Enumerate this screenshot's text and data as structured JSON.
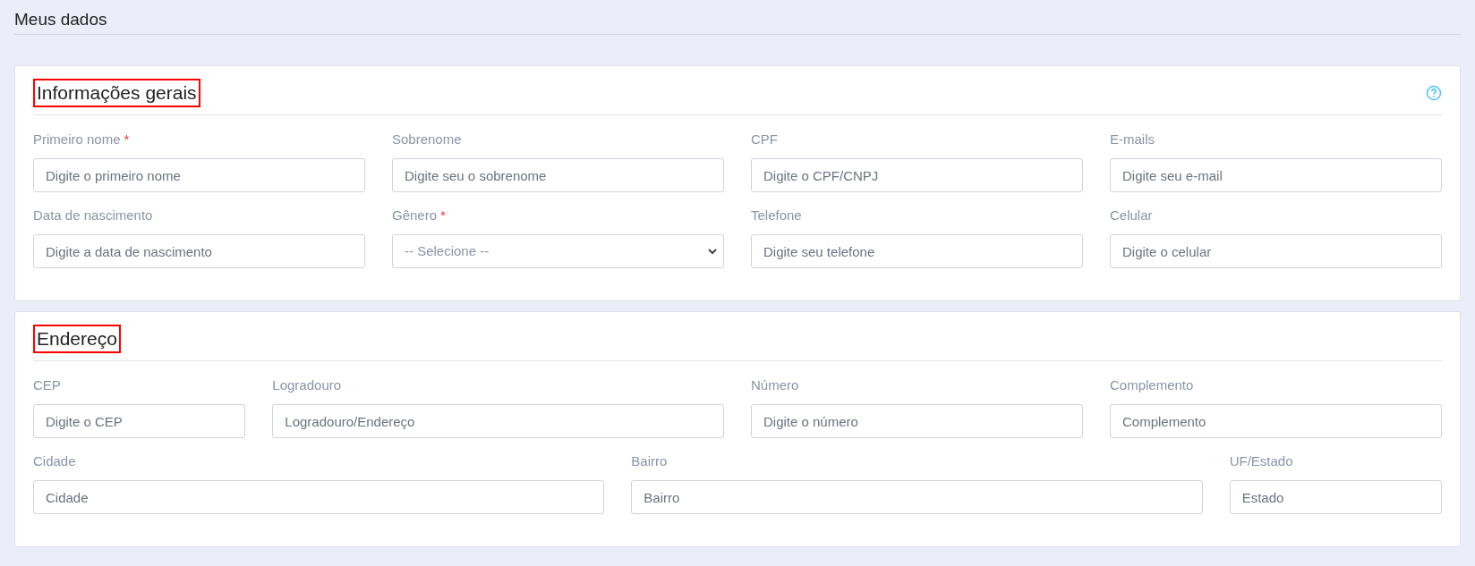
{
  "page_title": "Meus dados",
  "sections": [
    {
      "title": "Informações gerais",
      "highlighted": true,
      "help": true,
      "rows": [
        [
          {
            "label": "Primeiro nome",
            "required_mark": "*",
            "kind": "input",
            "placeholder": "Digite o primeiro nome"
          },
          {
            "label": "Sobrenome",
            "kind": "input",
            "placeholder": "Digite seu o sobrenome"
          },
          {
            "label": "CPF",
            "kind": "input",
            "placeholder": "Digite o CPF/CNPJ"
          },
          {
            "label": "E-mails",
            "kind": "input",
            "placeholder": "Digite seu e-mail"
          }
        ],
        [
          {
            "label": "Data de nascimento",
            "kind": "input",
            "placeholder": "Digite a data de nascimento"
          },
          {
            "label": "Gênero",
            "required_mark": "*",
            "kind": "select",
            "value": "-- Selecione --"
          },
          {
            "label": "Telefone",
            "kind": "input",
            "placeholder": "Digite seu telefone"
          },
          {
            "label": "Celular",
            "kind": "input",
            "placeholder": "Digite o celular"
          }
        ]
      ]
    },
    {
      "title": "Endereço",
      "highlighted": true,
      "rows": [
        [
          {
            "label": "CEP",
            "kind": "input",
            "placeholder": "Digite o CEP"
          },
          {
            "label": "Logradouro",
            "kind": "input",
            "placeholder": "Logradouro/Endereço"
          },
          {
            "label": "Número",
            "kind": "input",
            "placeholder": "Digite o número"
          },
          {
            "label": "Complemento",
            "kind": "input",
            "placeholder": "Complemento"
          }
        ],
        [
          {
            "label": "Cidade",
            "kind": "input",
            "placeholder": "Cidade"
          },
          {
            "label": "Bairro",
            "kind": "input",
            "placeholder": "Bairro"
          },
          {
            "label": "UF/Estado",
            "kind": "input",
            "placeholder": "Estado"
          }
        ]
      ]
    }
  ]
}
